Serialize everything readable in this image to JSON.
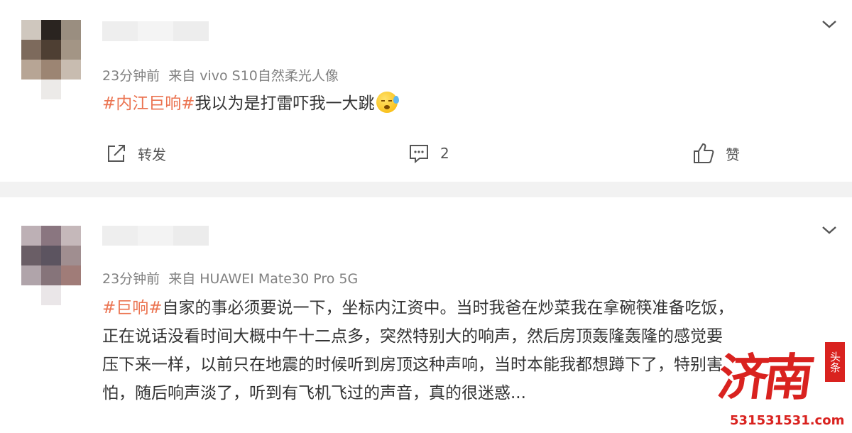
{
  "colors": {
    "hashtag": "#eb7350",
    "meta": "#808080",
    "text": "#333333",
    "divider": "#f2f2f2",
    "watermark": "#d9221f"
  },
  "posts": [
    {
      "meta": {
        "time": "23分钟前",
        "source": "来自 vivo S10自然柔光人像"
      },
      "hashtag": "#内江巨响#",
      "body": [
        "我以为是打雷吓我一大跳"
      ],
      "emoji_icon": "sweat-smile-icon",
      "actions": {
        "repost": "转发",
        "comment": "",
        "comment_count": "2",
        "like": "赞"
      }
    },
    {
      "meta": {
        "time": "23分钟前",
        "source": "来自 HUAWEI Mate30 Pro 5G"
      },
      "hashtag": "#巨响#",
      "body": [
        "自家的事必须要说一下，坐标内江资中。当时我爸在炒菜我在拿碗筷准备吃饭，",
        "正在说话没看时间大概中午十二点多，突然特别大的响声，然后房顶轰隆轰隆的感觉要",
        "压下来一样，以前只在地震的时候听到房顶这种声响，当时本能我都想蹲下了，特别害",
        "怕，随后响声淡了，听到有飞机飞过的声音，真的很迷惑..."
      ]
    }
  ],
  "watermark": {
    "logo_text": "济南",
    "seal_text": "头条",
    "url": "531531531.com"
  }
}
